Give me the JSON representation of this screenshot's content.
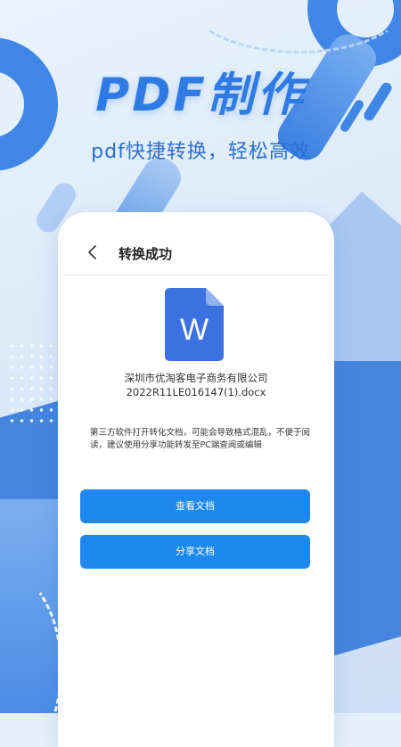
{
  "hero": {
    "title": "PDF制作",
    "subtitle": "pdf快捷转换，轻松高效"
  },
  "screen": {
    "header_title": "转换成功",
    "back_icon": "chevron-left-icon",
    "document": {
      "icon": "word-document-icon",
      "icon_letter": "W",
      "icon_color": "#3c72e0",
      "name_line1": "深圳市优淘客电子商务有限公司",
      "name_line2": "2022R11LE016147(1).docx"
    },
    "notice": "第三方软件打开转化文档，可能会导致格式混乱，不便于阅读，建议使用分享功能转发至PC端查阅或编辑",
    "buttons": {
      "view_label": "查看文档",
      "share_label": "分享文档"
    }
  },
  "colors": {
    "brand_blue": "#2f7be6",
    "button_blue": "#1e88ef"
  }
}
